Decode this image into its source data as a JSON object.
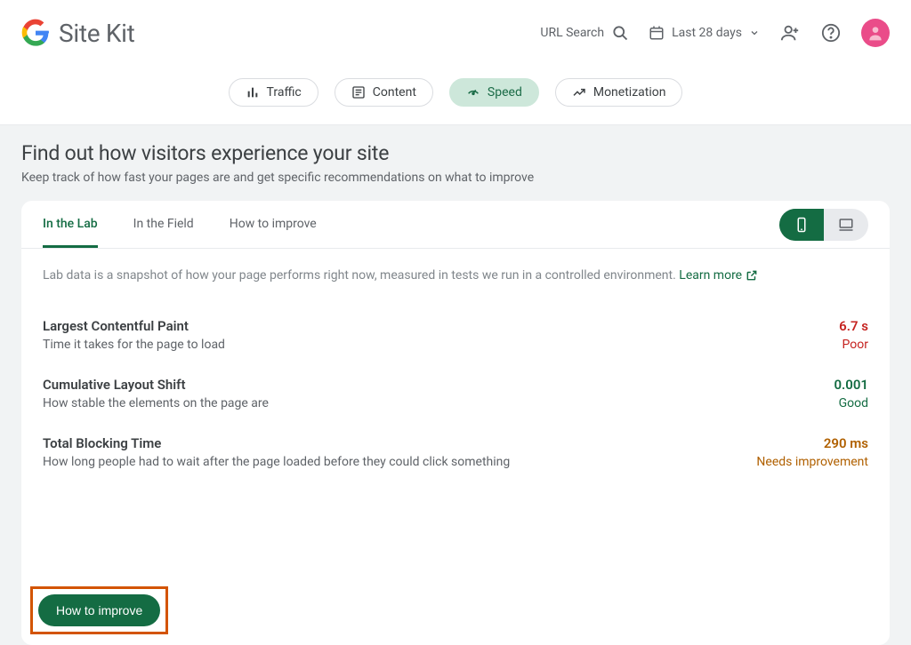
{
  "header": {
    "product": "Site Kit",
    "url_search_label": "URL Search",
    "date_range_label": "Last 28 days"
  },
  "nav_tabs": {
    "traffic": "Traffic",
    "content": "Content",
    "speed": "Speed",
    "monetization": "Monetization"
  },
  "hero": {
    "title": "Find out how visitors experience your site",
    "subtitle": "Keep track of how fast your pages are and get specific recommendations on what to improve"
  },
  "subtabs": {
    "in_lab": "In the Lab",
    "in_field": "In the Field",
    "how_to_improve": "How to improve"
  },
  "lab_intro": {
    "text": "Lab data is a snapshot of how your page performs right now, measured in tests we run in a controlled environment.",
    "learn_more": "Learn more"
  },
  "metrics": [
    {
      "title": "Largest Contentful Paint",
      "desc": "Time it takes for the page to load",
      "value": "6.7 s",
      "status": "Poor",
      "class": "c-poor"
    },
    {
      "title": "Cumulative Layout Shift",
      "desc": "How stable the elements on the page are",
      "value": "0.001",
      "status": "Good",
      "class": "c-good"
    },
    {
      "title": "Total Blocking Time",
      "desc": "How long people had to wait after the page loaded before they could click something",
      "value": "290 ms",
      "status": "Needs improvement",
      "class": "c-warn"
    }
  ],
  "cta": {
    "label": "How to improve"
  }
}
